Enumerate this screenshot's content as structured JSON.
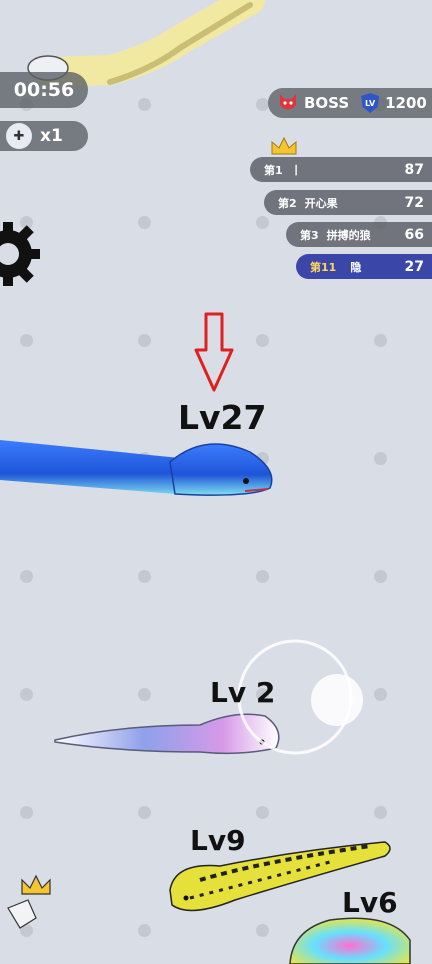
{
  "hud": {
    "timer": "00:56",
    "ghost_icon": "ghost-icon",
    "multiplier": "x1",
    "boss_label": "BOSS",
    "lv_badge": "LV",
    "level_score": "1200"
  },
  "leaderboard": {
    "crown_icon": "crown-icon",
    "rows": [
      {
        "rank": "第1",
        "name": "丨",
        "score": "87"
      },
      {
        "rank": "第2",
        "name": "开心果",
        "score": "72"
      },
      {
        "rank": "第3",
        "name": "拼搏的狼",
        "score": "66"
      },
      {
        "rank": "第11",
        "name": "隐",
        "score": "27"
      }
    ]
  },
  "snakes": [
    {
      "label": "Lv27",
      "color": "#2f6fe6"
    },
    {
      "label": "Lv 2",
      "color": "#b89be8"
    },
    {
      "label": "Lv9",
      "color": "#e9e03a"
    },
    {
      "label": "Lv6",
      "color": "#c4d04a"
    }
  ],
  "controls": {
    "settings_icon": "gear-icon",
    "joystick": "joystick"
  },
  "colors": {
    "background": "#d9dee6",
    "arrow": "#e02020",
    "panel": "#5a5d64",
    "player_row": "#3b47a8"
  }
}
